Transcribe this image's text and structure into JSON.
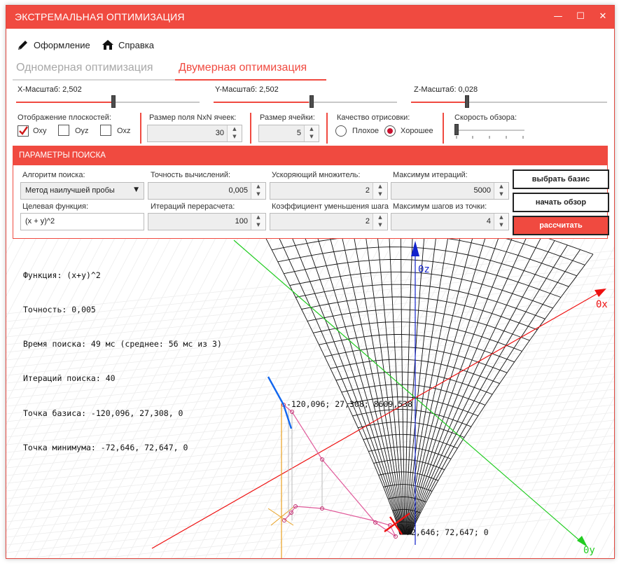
{
  "window": {
    "title": "ЭКСТРЕМАЛЬНАЯ ОПТИМИЗАЦИЯ",
    "minimize_glyph": "—",
    "maximize_glyph": "☐",
    "close_glyph": "✕"
  },
  "menu": {
    "design_label": "Оформление",
    "help_label": "Справка"
  },
  "tabs": [
    {
      "label": "Одномерная оптимизация",
      "active": false
    },
    {
      "label": "Двумерная оптимизация",
      "active": true
    }
  ],
  "scales": {
    "x_label": "X-Масштаб: 2,502",
    "y_label": "Y-Масштаб: 2,502",
    "z_label": "Z-Масштаб: 0,028"
  },
  "planes": {
    "label": "Отображение плоскостей:",
    "oxy": {
      "label": "Oxy",
      "checked": true
    },
    "oyz": {
      "label": "Oyz",
      "checked": false
    },
    "oxz": {
      "label": "Oxz",
      "checked": false
    }
  },
  "grid_size": {
    "label": "Размер поля NxN ячеек:",
    "value": "30"
  },
  "cell_size": {
    "label": "Размер ячейки:",
    "value": "5"
  },
  "quality": {
    "label": "Качество отрисовки:",
    "bad": "Плохое",
    "good": "Хорошее",
    "selected": "good"
  },
  "view_speed": {
    "label": "Скорость обзора:"
  },
  "params": {
    "header": "ПАРАМЕТРЫ ПОИСКА",
    "algorithm_label": "Алгоритм поиска:",
    "algorithm_value": "Метод наилучшей пробы",
    "precision_label": "Точность вычислений:",
    "precision_value": "0,005",
    "accel_label": "Ускоряющий множитель:",
    "accel_value": "2",
    "max_iter_label": "Максимум итераций:",
    "max_iter_value": "5000",
    "target_label": "Целевая функция:",
    "target_value": "(x + y)^2",
    "recalc_label": "Итераций перерасчета:",
    "recalc_value": "100",
    "reduce_label": "Коэффициент уменьшения шага:",
    "reduce_value": "2",
    "max_steps_label": "Максимум шагов из точки:",
    "max_steps_value": "4",
    "choose_basis_button": "выбрать базис",
    "start_view_button": "начать обзор",
    "calculate_button": "рассчитать"
  },
  "info": {
    "function": "Функция: (x+y)^2",
    "precision": "Точность: 0,005",
    "time": "Время поиска: 49 мс (среднее: 56 мс из 3)",
    "iterations": "Итераций поиска: 40",
    "basis": "Точка базиса: -120,096, 27,308, 0",
    "minimum": "Точка минимума: -72,646, 72,647, 0"
  },
  "scene": {
    "axis_z": "0z",
    "axis_x": "0x",
    "axis_y": "0y",
    "start_point_label": "-120,096; 27,308; 8609,538",
    "min_point_label": "-72,646; 72,647; 0"
  },
  "colors": {
    "accent": "#f04a40",
    "axis_x": "#ee1111",
    "axis_y": "#22cc22",
    "axis_z": "#1122cc",
    "path": "#e05a9a"
  }
}
